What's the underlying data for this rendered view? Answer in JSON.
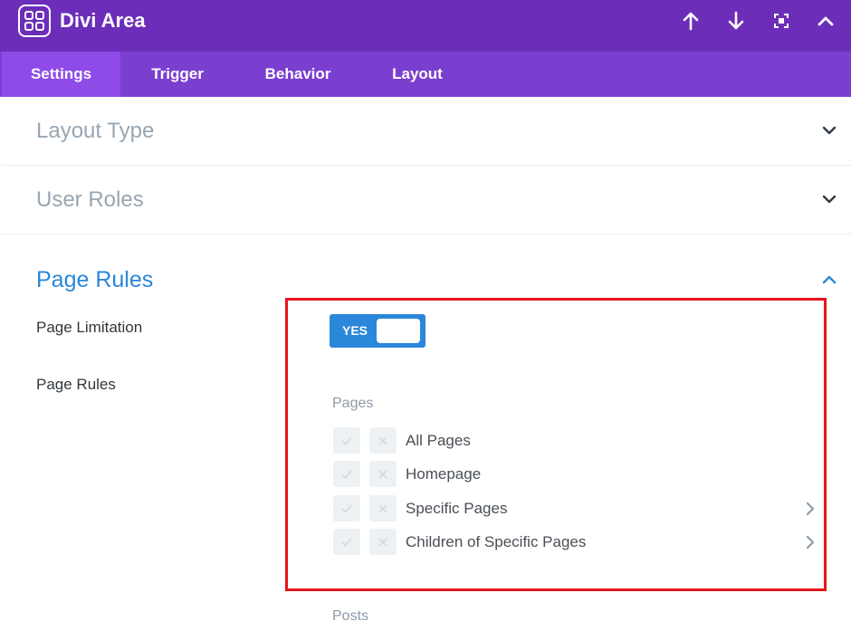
{
  "header": {
    "title": "Divi Area",
    "logo_icon": "divi-area-logo-icon",
    "buttons": [
      "move-up-icon",
      "move-down-icon",
      "fullscreen-icon",
      "collapse-icon"
    ],
    "bg_color": "#6c2eb9"
  },
  "tabs": [
    {
      "label": "Settings",
      "active": true
    },
    {
      "label": "Trigger",
      "active": false
    },
    {
      "label": "Behavior",
      "active": false
    },
    {
      "label": "Layout",
      "active": false
    }
  ],
  "sections": {
    "layout_type": {
      "title": "Layout Type",
      "expanded": false
    },
    "user_roles": {
      "title": "User Roles",
      "expanded": false
    },
    "page_rules": {
      "title": "Page Rules",
      "expanded": true
    }
  },
  "fields": {
    "page_limitation": {
      "label": "Page Limitation",
      "toggle_text": "YES",
      "value": true
    },
    "page_rules": {
      "label": "Page Rules"
    }
  },
  "rules": {
    "pages_group_label": "Pages",
    "pages": [
      {
        "label": "All Pages",
        "has_submenu": false
      },
      {
        "label": "Homepage",
        "has_submenu": false
      },
      {
        "label": "Specific Pages",
        "has_submenu": true
      },
      {
        "label": "Children of Specific Pages",
        "has_submenu": true
      }
    ],
    "posts_group_label": "Posts"
  },
  "colors": {
    "accent": "#2b87da",
    "highlight_border": "#e8141c",
    "tab_active": "#8e4be7"
  }
}
